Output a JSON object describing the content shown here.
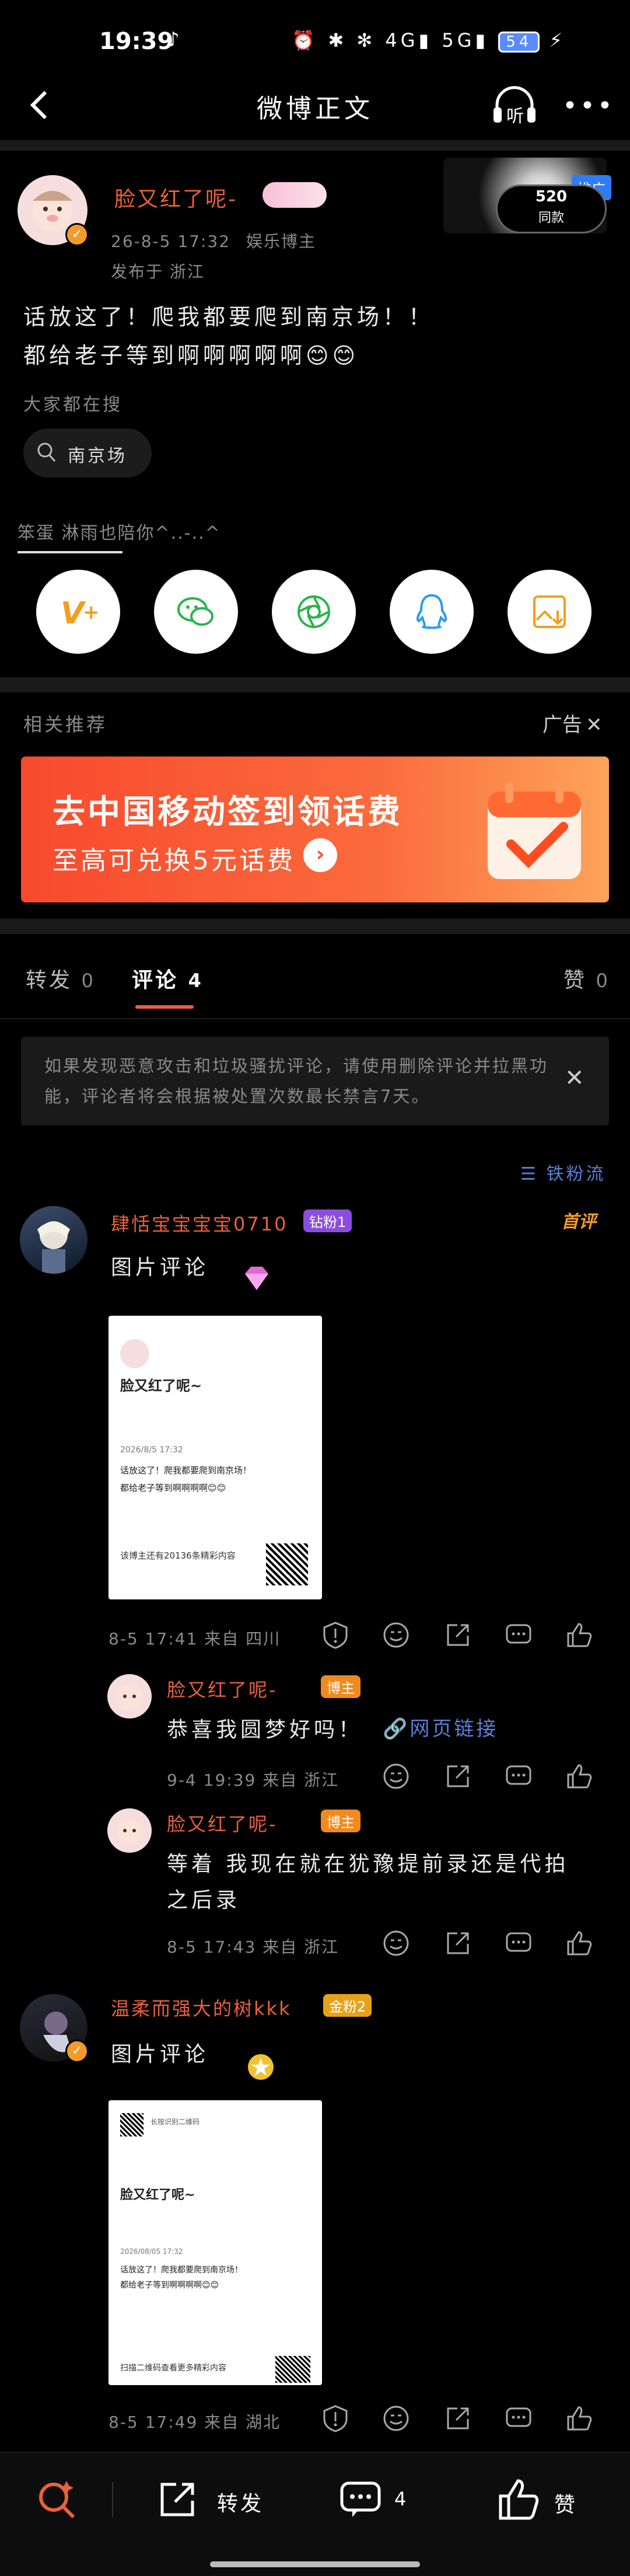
{
  "status_bar": {
    "time": "19:39",
    "battery": "54"
  },
  "nav": {
    "title": "微博正文",
    "listen": "听"
  },
  "post": {
    "author": "脸又红了呢-",
    "meta_date": "26-8-5 17:32",
    "meta_role": "娱乐博主",
    "meta_location": "发布于 浙江",
    "text_line1": "话放这了！爬我都要爬到南京场！！",
    "text_line2": "都给老子等到啊啊啊啊啊😊😊",
    "ad_badge": "推广",
    "ad_text_top": "520",
    "ad_text_bottom": "同款",
    "search_label": "大家都在搜",
    "search_chip": "南京场",
    "footer_note": "笨蛋 淋雨也陪你^..-..^"
  },
  "share_targets": [
    {
      "name": "vplus",
      "label": "V+"
    },
    {
      "name": "wechat",
      "label": "微信"
    },
    {
      "name": "moments",
      "label": "朋友圈"
    },
    {
      "name": "qq",
      "label": "QQ"
    },
    {
      "name": "save-image",
      "label": "保存图片"
    }
  ],
  "recommend": {
    "label": "相关推荐",
    "ad_label": "广告",
    "banner_title": "去中国移动签到领话费",
    "banner_sub": "至高可兑换5元话费"
  },
  "tabs": {
    "repost": "转发",
    "repost_count": "0",
    "comment": "评论",
    "comment_count": "4",
    "like": "赞",
    "like_count": "0"
  },
  "notice": "如果发现恶意攻击和垃圾骚扰评论，请使用删除评论并拉黑功能，评论者将会根据被处置次数最长禁言7天。",
  "fans_flow": "铁粉流",
  "comments": [
    {
      "name": "肆恬宝宝宝宝0710",
      "badge": "钻粉1",
      "tag": "首评",
      "text": "图片评论",
      "meta": "8-5 17:41  来自 四川",
      "card_name": "脸又红了呢~",
      "card_line1": "话放这了！爬我都要爬到南京场！",
      "card_line2": "都给老子等到啊啊啊啊😊😊",
      "card_footer": "该博主还有20136条精彩内容",
      "card_date": "2026/8/5 17:32"
    },
    {
      "name": "脸又红了呢-",
      "badge": "博主",
      "text": "恭喜我圆梦好吗！",
      "link": "网页链接",
      "meta": "9-4 19:39  来自 浙江"
    },
    {
      "name": "脸又红了呢-",
      "badge": "博主",
      "text1": "等着 我现在就在犹豫提前录还是代拍",
      "text2": "之后录",
      "meta": "8-5 17:43  来自 浙江"
    },
    {
      "name": "温柔而强大的树kkk",
      "badge": "金粉2",
      "text": "图片评论",
      "meta": "8-5 17:49  来自 湖北",
      "card_name": "脸又红了呢~",
      "card_top": "长按识别二维码",
      "card_line1": "话放这了！爬我都要爬到南京场！",
      "card_line2": "都给老子等到啊啊啊啊😊😊",
      "card_footer": "扫描二维码查看更多精彩内容",
      "card_date": "2026/08/05 17:32"
    }
  ],
  "bottom_bar": {
    "repost": "转发",
    "comment_count": "4",
    "like": "赞"
  }
}
